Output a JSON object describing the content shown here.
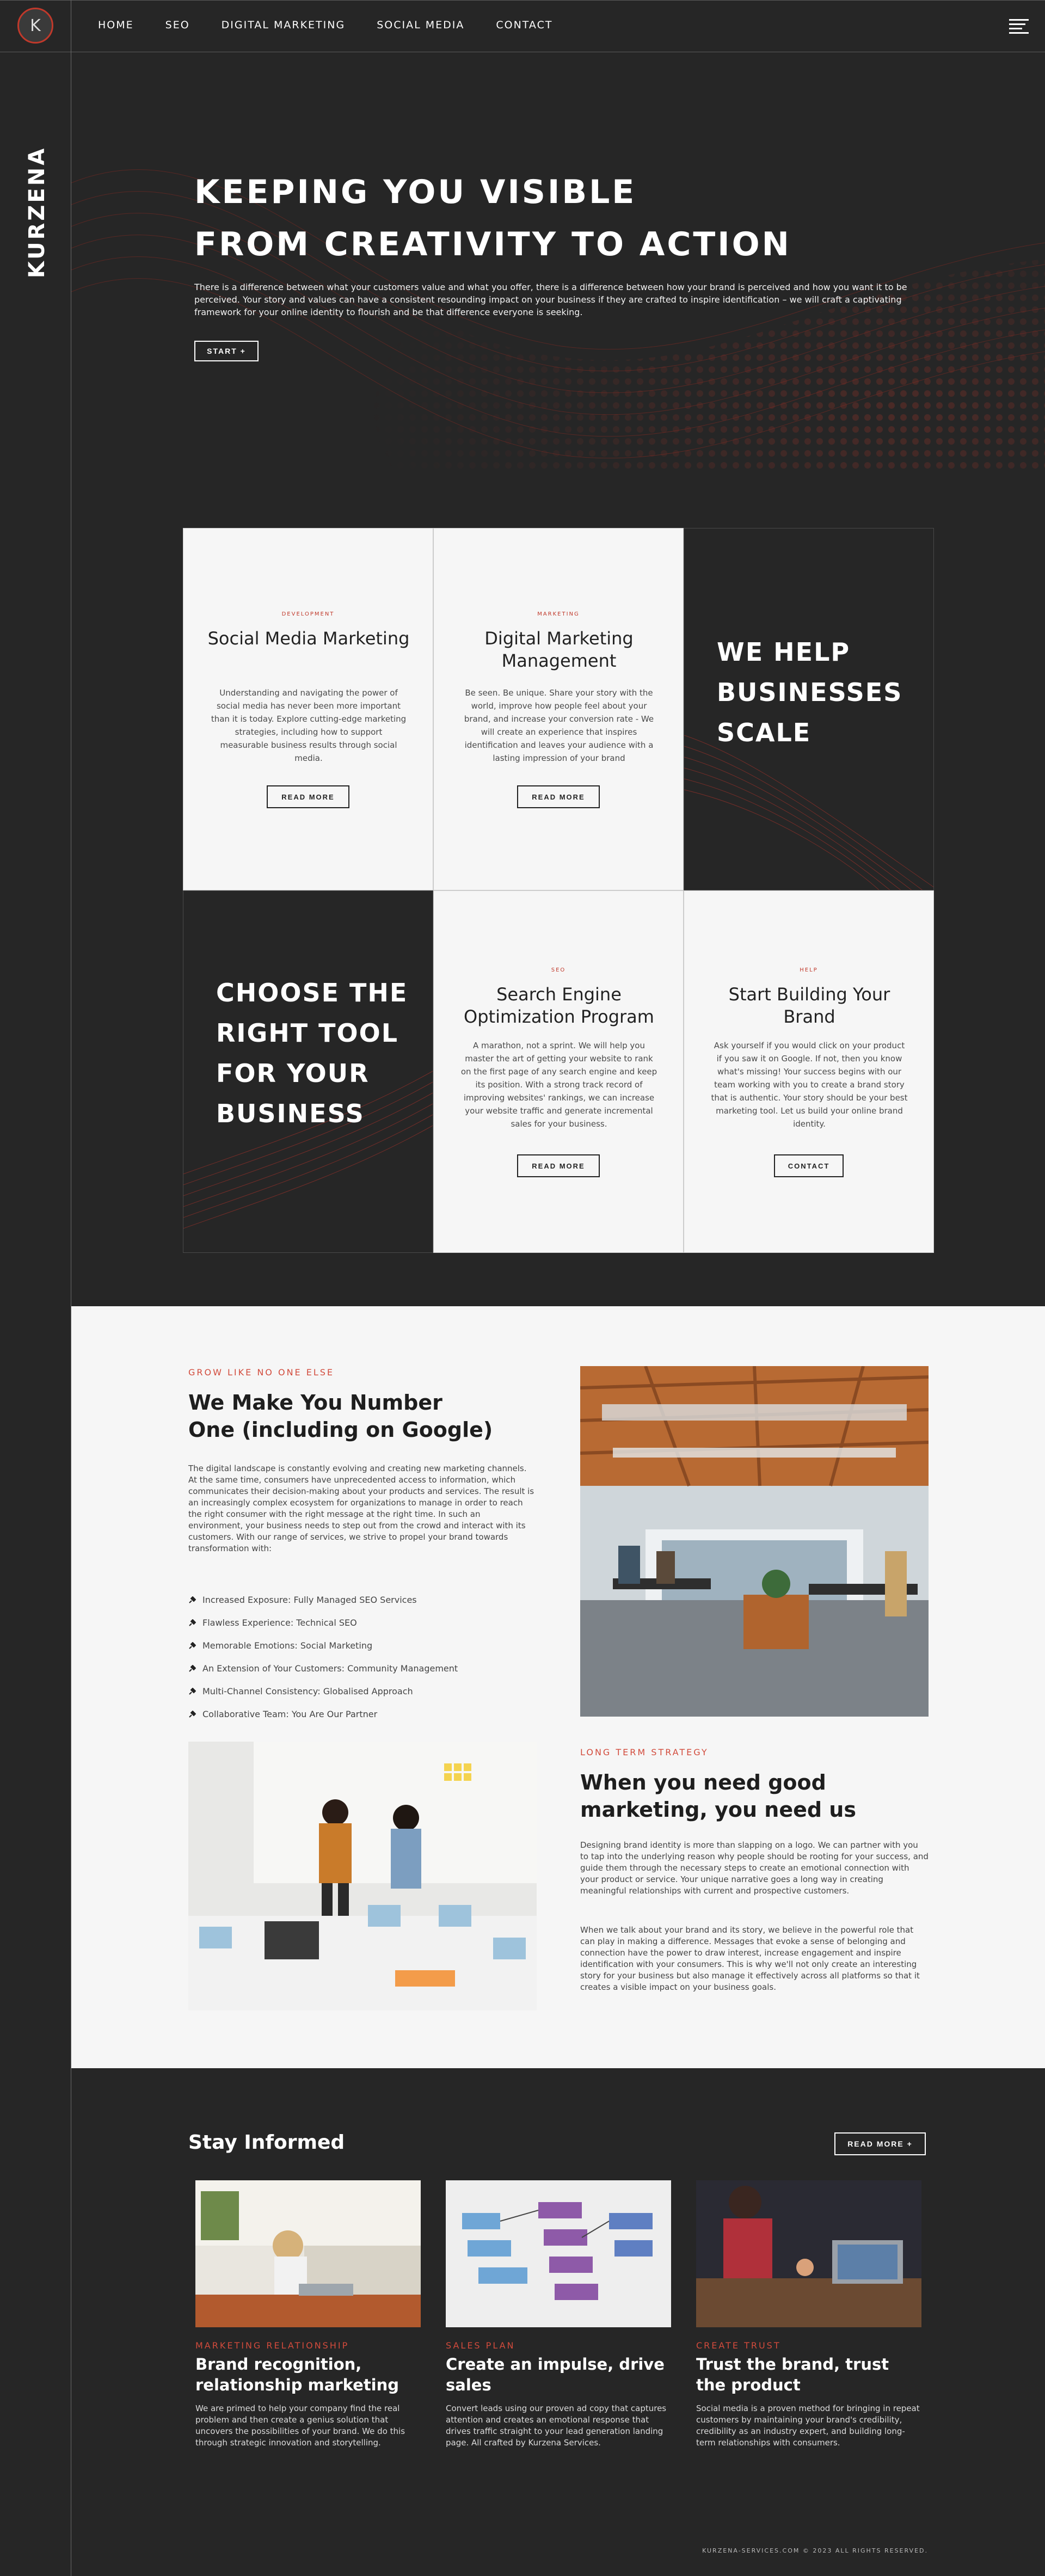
{
  "brand": {
    "name": "KURZENA",
    "logo_letter": "K"
  },
  "nav": {
    "items": [
      "HOME",
      "SEO",
      "DIGITAL MARKETING",
      "SOCIAL MEDIA",
      "CONTACT"
    ]
  },
  "hero": {
    "title_line1": "KEEPING YOU VISIBLE",
    "title_line2": "FROM CREATIVITY TO ACTION",
    "description": "There is a difference between what your customers value and what you offer, there is a difference between how your brand is perceived and how you want it to be perceived. Your story and values can have a consistent resounding impact on your business if they are crafted to inspire identification – we will craft a captivating framework for your online identity to flourish and be that difference everyone is seeking.",
    "cta": "START +"
  },
  "services": {
    "social": {
      "tag": "DEVELOPMENT",
      "title": "Social Media Marketing",
      "desc": "Understanding and navigating the power of social media has never been more important than it is today. Explore cutting-edge marketing strategies, including how to support measurable business results through social media.",
      "button": "READ MORE"
    },
    "digital": {
      "tag": "MARKETING",
      "title": "Digital Marketing Management",
      "desc": "Be seen. Be unique. Share your story with the world, improve how people feel about your brand, and increase your conversion rate - We will create an experience that inspires identification and leaves your audience with a lasting impression of your brand",
      "button": "READ MORE"
    },
    "scale_lines": [
      "WE HELP",
      "BUSINESSES",
      "SCALE"
    ],
    "choose_lines": [
      "CHOOSE THE",
      "RIGHT TOOL",
      "FOR YOUR",
      "BUSINESS"
    ],
    "seo": {
      "tag": "SEO",
      "title": "Search Engine Optimization Program",
      "desc": "A marathon, not a sprint. We will help you master the art of getting your website to rank on the first page of any search engine and keep its position. With a strong track record of improving websites' rankings, we can increase your website traffic and generate incremental sales for your business.",
      "button": "READ MORE"
    },
    "brand": {
      "tag": "HELP",
      "title": "Start Building Your Brand",
      "desc": "Ask yourself if you would click on your product if you saw it on Google. If not, then you know what's missing! Your success begins with our team working with you to create a brand story that is authentic. Your story should be your best marketing tool. Let us build your online brand identity.",
      "button": "CONTACT"
    }
  },
  "growth": {
    "eyebrow": "GROW LIKE NO ONE ELSE",
    "title": "We Make You Number One (including on Google)",
    "para": "The digital landscape is constantly evolving and creating new marketing channels. At the same time, consumers have unprecedented access to information, which communicates their decision-making about your products and services. The result is an increasingly complex ecosystem for organizations to manage in order to reach the right consumer with the right message at the right time. In such an environment, your business needs to step out from the crowd and interact with its customers. With our range of services, we strive to propel your brand towards transformation with:",
    "bullets": [
      "Increased Exposure: Fully Managed SEO Services",
      "Flawless Experience: Technical SEO",
      "Memorable Emotions: Social Marketing",
      "An Extension of Your Customers: Community Management",
      "Multi-Channel Consistency: Globalised Approach",
      "Collaborative Team: You Are Our Partner"
    ],
    "eyebrow2": "LONG TERM STRATEGY",
    "title2": "When you need good marketing, you need us",
    "para2a": "Designing brand identity is more than slapping on a logo. We can partner with you to tap into the underlying reason why people should be rooting for your success, and guide them through the necessary steps to create an emotional connection with your product or service. Your unique narrative goes a long way in creating meaningful relationships with current and prospective customers.",
    "para2b": "When we talk about your brand and its story, we believe in the powerful role that can play in making a difference. Messages that evoke a sense of belonging and connection have the power to draw interest, increase engagement and inspire identification with your consumers. This is why we'll not only create an interesting story for your business but also manage it effectively across all platforms so that it creates a visible impact on your business goals."
  },
  "stay": {
    "title": "Stay Informed",
    "button": "READ MORE +",
    "posts": [
      {
        "category": "MARKETING RELATIONSHIP",
        "title": "Brand recognition, relationship marketing",
        "desc": "We are primed to help your company find the real problem and then create a genius solution that uncovers the possibilities of your brand. We do this through strategic innovation and storytelling."
      },
      {
        "category": "SALES PLAN",
        "title": "Create an impulse, drive sales",
        "desc": "Convert leads using our proven ad copy that captures attention and creates an emotional response that drives traffic straight to your lead generation landing page. All crafted by Kurzena Services."
      },
      {
        "category": "CREATE TRUST",
        "title": "Trust the brand, trust the product",
        "desc": "Social media is a proven method for bringing in repeat customers by maintaining your brand's credibility, credibility as an industry expert, and building long-term relationships with consumers."
      }
    ],
    "footer": "KURZENA-SERVICES.COM © 2023 ALL RIGHTS RESERVED."
  },
  "colors": {
    "background": "#262626",
    "accent": "#c0392b",
    "light": "#f6f6f6"
  },
  "icons": [
    "hamburger-menu-icon",
    "pin-icon"
  ]
}
